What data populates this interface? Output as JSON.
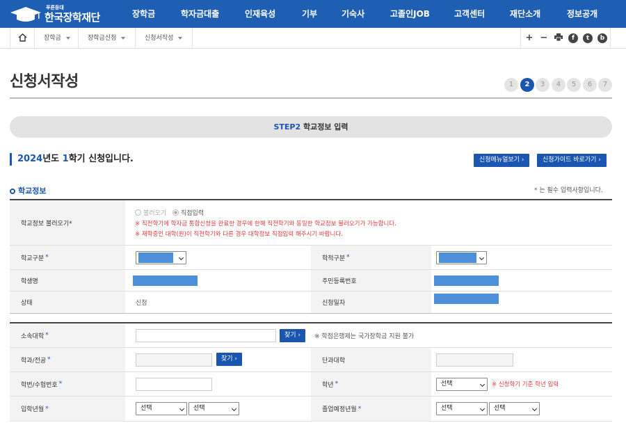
{
  "brand": {
    "sub": "푸른등대",
    "name": "한국장학재단"
  },
  "menu": [
    "장학금",
    "학자금대출",
    "인재육성",
    "기부",
    "기숙사",
    "고졸인JOB",
    "고객센터",
    "재단소개",
    "정보공개"
  ],
  "breadcrumb": [
    "장학금",
    "장학금신청",
    "신청서작성"
  ],
  "tools": {
    "zoom_in": "+",
    "zoom_out": "−",
    "print": "print-icon",
    "social": [
      "f",
      "t",
      "b"
    ]
  },
  "page": {
    "title": "신청서작성",
    "steps": [
      "1",
      "2",
      "3",
      "4",
      "5",
      "6",
      "7"
    ],
    "active_step": 2
  },
  "step_bar": {
    "step": "STEP2",
    "label": "학교정보 입력"
  },
  "semester": {
    "year": "2024",
    "year_suffix": "년도 ",
    "term": "1",
    "term_suffix": "학기 신청입니다."
  },
  "buttons": {
    "manual": "신청메뉴얼보기 ›",
    "guide": "신청가이드 바로가기 ›"
  },
  "section": {
    "title": "학교정보",
    "required_note": "* 는 필수 입력사항입니다."
  },
  "school_info": {
    "load_label": "학교정보 불러오기*",
    "radio_load": "불러오기",
    "radio_direct": "직접입력",
    "warn1": "※ 직전학기에 학자금 통합신청을 완료한 경우에 한해 직전학기와 동일한 학교정보 불러오기가 가능합니다.",
    "warn2": "※ 재학중인 대학(원)이 직전학기와 다른 경우 대학정보 직접입력 해주시기 바랍니다.",
    "school_type_label": "학교구분",
    "student_status_label": "학적구분",
    "student_name_label": "학생명",
    "resident_no_label": "주민등록번호",
    "state_label": "상태",
    "state_value": "신청",
    "apply_date_label": "신청일자"
  },
  "university": {
    "univ_label": "소속대학",
    "find": "찾기 ›",
    "univ_note": "※ 학점은행제는 국가장학금 지원 불가",
    "dept_label": "학과/전공",
    "college_label": "단과대학",
    "student_no_label": "학번/수험번호",
    "grade_label": "학년",
    "grade_value": "선택",
    "grade_note": "※ 신청학기 기준 학년 입력",
    "entry_label": "입학년월",
    "entry_year": "선택",
    "entry_month": "선택",
    "grad_label": "졸업예정년월",
    "grad_year": "선택",
    "grad_month": "선택"
  },
  "required_mark": "*"
}
